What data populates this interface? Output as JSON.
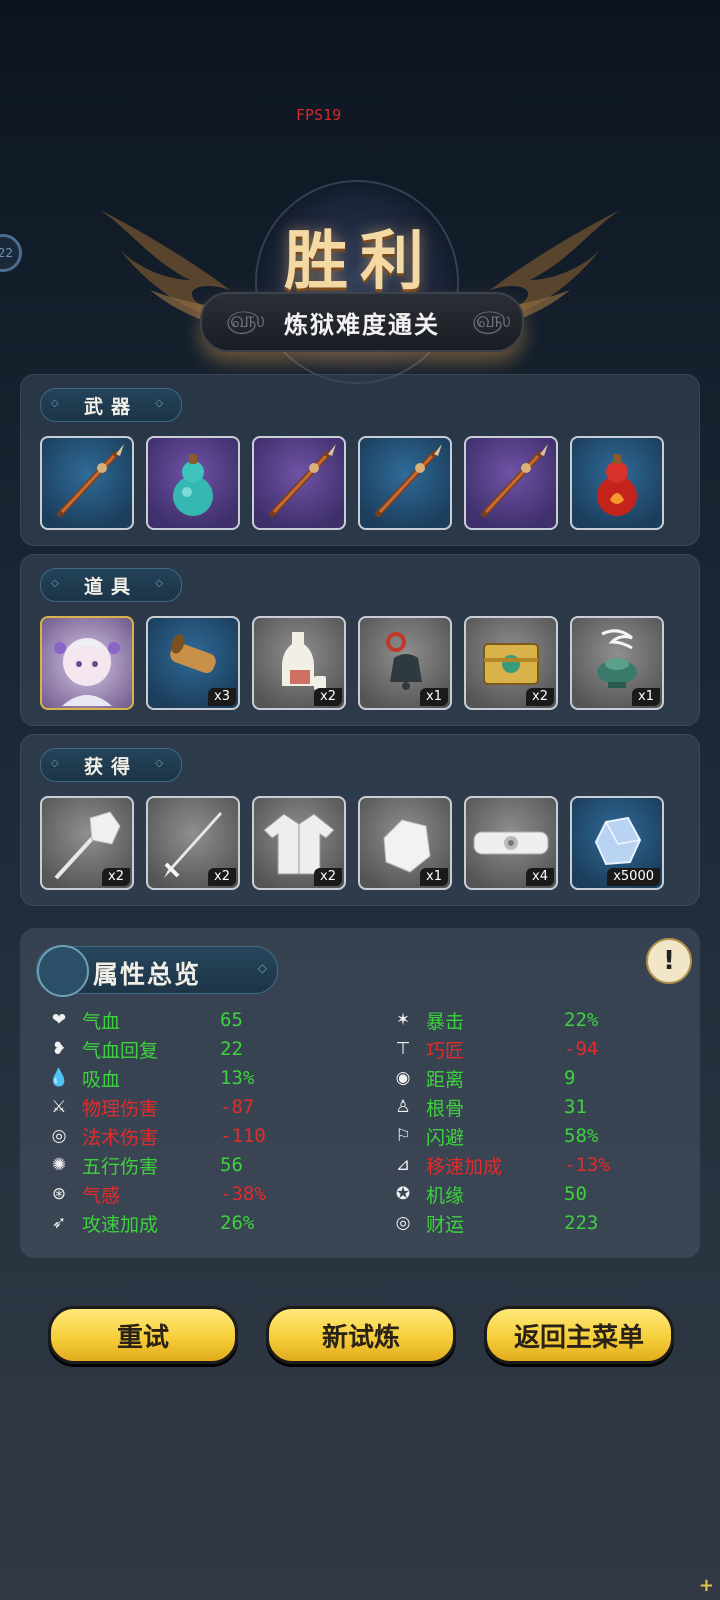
{
  "overlay": {
    "fps": "FPS19",
    "edge_badge": "22"
  },
  "header": {
    "title": "胜利",
    "subtitle": "炼狱难度通关"
  },
  "sections": {
    "weapons": {
      "label": "武器",
      "items": [
        {
          "icon": "spear-icon",
          "rarity": "blue"
        },
        {
          "icon": "cyan-gourd-icon",
          "rarity": "purple"
        },
        {
          "icon": "spear-icon",
          "rarity": "purple"
        },
        {
          "icon": "spear-icon",
          "rarity": "blue"
        },
        {
          "icon": "spear-icon",
          "rarity": "purple"
        },
        {
          "icon": "red-gourd-icon",
          "rarity": "blue"
        }
      ]
    },
    "items": {
      "label": "道具",
      "items": [
        {
          "icon": "character-portrait-icon",
          "rarity": "gold",
          "qty": ""
        },
        {
          "icon": "scroll-icon",
          "rarity": "blue",
          "qty": "x3"
        },
        {
          "icon": "wine-bottle-icon",
          "rarity": "gray",
          "qty": "x2"
        },
        {
          "icon": "bell-icon",
          "rarity": "gray",
          "qty": "x1"
        },
        {
          "icon": "golden-box-icon",
          "rarity": "gray",
          "qty": "x2"
        },
        {
          "icon": "incense-burner-icon",
          "rarity": "gray",
          "qty": "x1"
        }
      ]
    },
    "obtained": {
      "label": "获得",
      "items": [
        {
          "icon": "mace-icon",
          "rarity": "gray",
          "qty": "x2"
        },
        {
          "icon": "sword-icon",
          "rarity": "gray",
          "qty": "x2"
        },
        {
          "icon": "robe-icon",
          "rarity": "gray",
          "qty": "x2"
        },
        {
          "icon": "stone-icon",
          "rarity": "gray",
          "qty": "x1"
        },
        {
          "icon": "belt-icon",
          "rarity": "gray",
          "qty": "x4"
        },
        {
          "icon": "crystal-icon",
          "rarity": "blue",
          "qty": "x5000"
        }
      ]
    }
  },
  "attributes": {
    "title": "属性总览",
    "left": [
      {
        "icon": "heart-icon",
        "name": "气血",
        "value": "65",
        "color": "green"
      },
      {
        "icon": "heart-regen-icon",
        "name": "气血回复",
        "value": "22",
        "color": "green"
      },
      {
        "icon": "blood-drop-icon",
        "name": "吸血",
        "value": "13%",
        "color": "green"
      },
      {
        "icon": "blade-icon",
        "name": "物理伤害",
        "value": "-87",
        "color": "red"
      },
      {
        "icon": "spiral-icon",
        "name": "法术伤害",
        "value": "-110",
        "color": "red"
      },
      {
        "icon": "swirl-icon",
        "name": "五行伤害",
        "value": "56",
        "color": "green"
      },
      {
        "icon": "qi-icon",
        "name": "气感",
        "value": "-38%",
        "color": "red"
      },
      {
        "icon": "attack-speed-icon",
        "name": "攻速加成",
        "value": "26%",
        "color": "green"
      }
    ],
    "right": [
      {
        "icon": "crit-icon",
        "name": "暴击",
        "value": "22%",
        "color": "green"
      },
      {
        "icon": "hammer-icon",
        "name": "巧匠",
        "value": "-94",
        "color": "red"
      },
      {
        "icon": "target-icon",
        "name": "距离",
        "value": "9",
        "color": "green"
      },
      {
        "icon": "meditate-icon",
        "name": "根骨",
        "value": "31",
        "color": "green"
      },
      {
        "icon": "dodge-icon",
        "name": "闪避",
        "value": "58%",
        "color": "green"
      },
      {
        "icon": "boot-icon",
        "name": "移速加成",
        "value": "-13%",
        "color": "red"
      },
      {
        "icon": "fortune-wheel-icon",
        "name": "机缘",
        "value": "50",
        "color": "green"
      },
      {
        "icon": "coin-icon",
        "name": "财运",
        "value": "223",
        "color": "green"
      }
    ]
  },
  "buttons": {
    "retry": "重试",
    "new_trial": "新试炼",
    "main_menu": "返回主菜单"
  },
  "colors": {
    "gain": "#3dd23d",
    "loss": "#e22b2b",
    "button": "#f6cf3a"
  }
}
